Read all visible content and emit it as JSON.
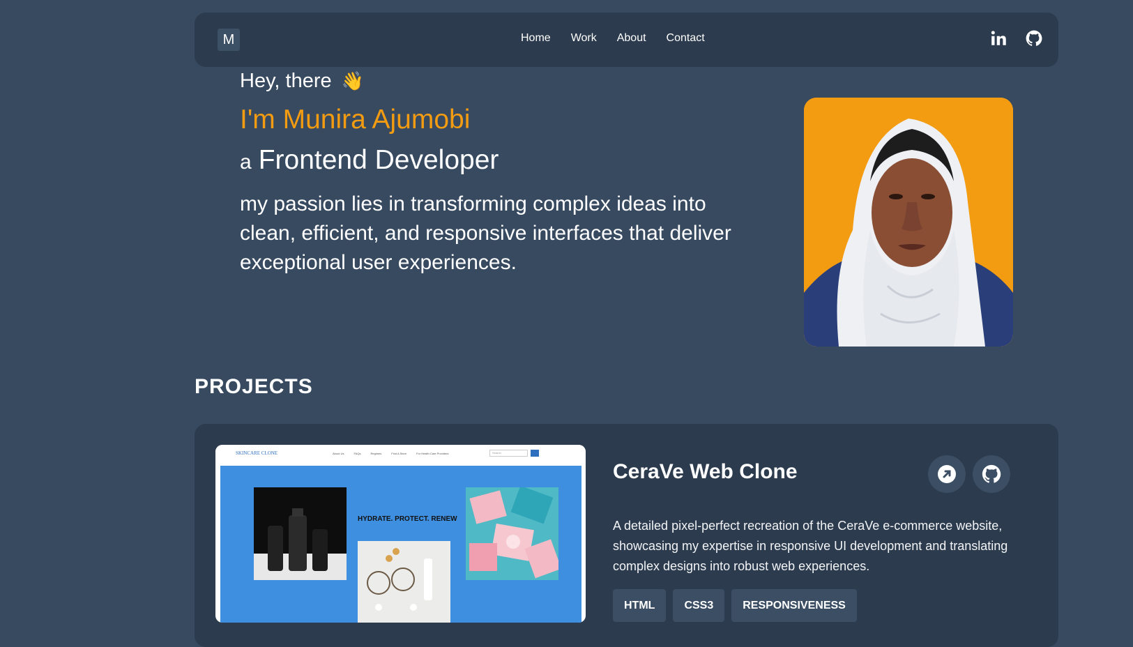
{
  "nav": {
    "logo": "M",
    "links": [
      "Home",
      "Work",
      "About",
      "Contact"
    ],
    "social_icons": [
      "linkedin-icon",
      "github-icon"
    ]
  },
  "hero": {
    "greeting": "Hey, there",
    "wave_emoji": "👋",
    "name": "I'm Munira Ajumobi",
    "role_prefix": "a",
    "role": "Frontend Developer",
    "description": "my passion lies in transforming complex ideas into clean, efficient, and responsive interfaces that deliver exceptional user experiences."
  },
  "projects": {
    "heading": "PROJECTS",
    "items": [
      {
        "title": "CeraVe Web Clone",
        "thumbnail": {
          "brand": "SKINCARE CLONE",
          "menu": [
            "About Us",
            "FAQs",
            "Regimes",
            "Find A Store",
            "For Health Care Providers"
          ],
          "search_placeholder": "Search",
          "tagline": "HYDRATE. PROTECT. RENEW"
        },
        "description": "A detailed pixel-perfect recreation of the CeraVe e-commerce website, showcasing my expertise in responsive UI development and translating complex designs into robust web experiences.",
        "tags": [
          "HTML",
          "CSS3",
          "RESPONSIVENESS"
        ],
        "action_icons": [
          "external-link-icon",
          "github-icon"
        ]
      }
    ]
  },
  "colors": {
    "background": "#374a60",
    "card": "#2c3b4d",
    "accent": "#f39c12"
  }
}
